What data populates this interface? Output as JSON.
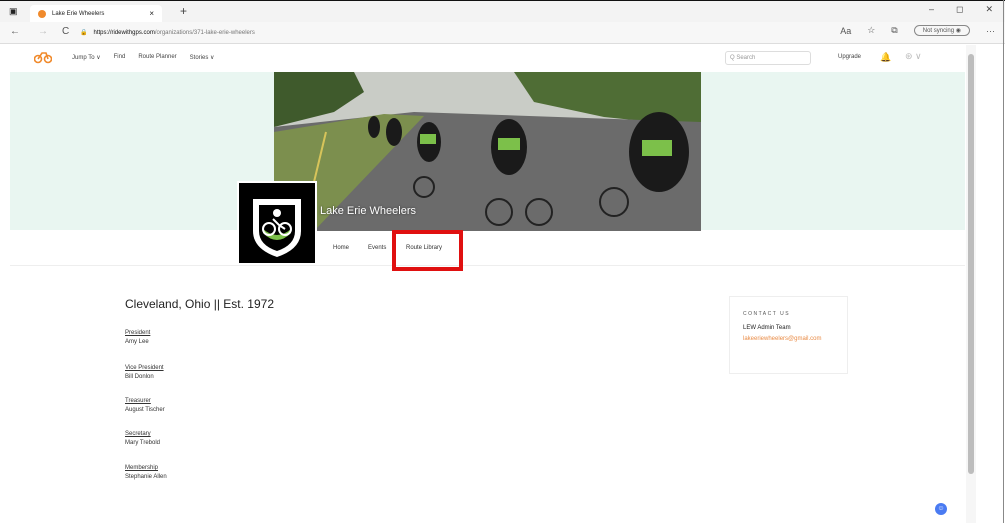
{
  "browser": {
    "tab_title": "Lake Erie Wheelers",
    "tab_close": "×",
    "new_tab": "+",
    "url_host": "https://ridewithgps.com",
    "url_path": "/organizations/371-lake-erie-wheelers",
    "sync_label": "Not syncing",
    "window_controls": [
      "–",
      "◻",
      "✕"
    ],
    "back": "←",
    "forward": "→",
    "reload": "C",
    "more": "···"
  },
  "site": {
    "menu": [
      "Jump To ∨",
      "Find",
      "Route Planner",
      "Stories ∨"
    ],
    "search_placeholder": "Q Search",
    "upgrade": "Upgrade",
    "bell": "🔔"
  },
  "club": {
    "name": "Lake Erie Wheelers",
    "tabs": [
      "Home",
      "Events",
      "Route Library"
    ],
    "highlighted_tab": "Route Library"
  },
  "main": {
    "location": "Cleveland, Ohio || Est. 1972",
    "officers": [
      {
        "role": "President",
        "name": "Amy Lee"
      },
      {
        "role": "Vice President",
        "name": "Bill Donlon"
      },
      {
        "role": "Treasurer",
        "name": "August Tischer"
      },
      {
        "role": "Secretary",
        "name": "Mary Trebold"
      },
      {
        "role": "Membership",
        "name": "Stephanie Allen"
      }
    ]
  },
  "contact": {
    "heading": "CONTACT US",
    "team": "LEW Admin Team",
    "email": "lakeeriewheelers@gmail.com"
  },
  "colors": {
    "accent": "#e98b45",
    "highlight": "#e01010",
    "mint": "#e9f6f1"
  }
}
